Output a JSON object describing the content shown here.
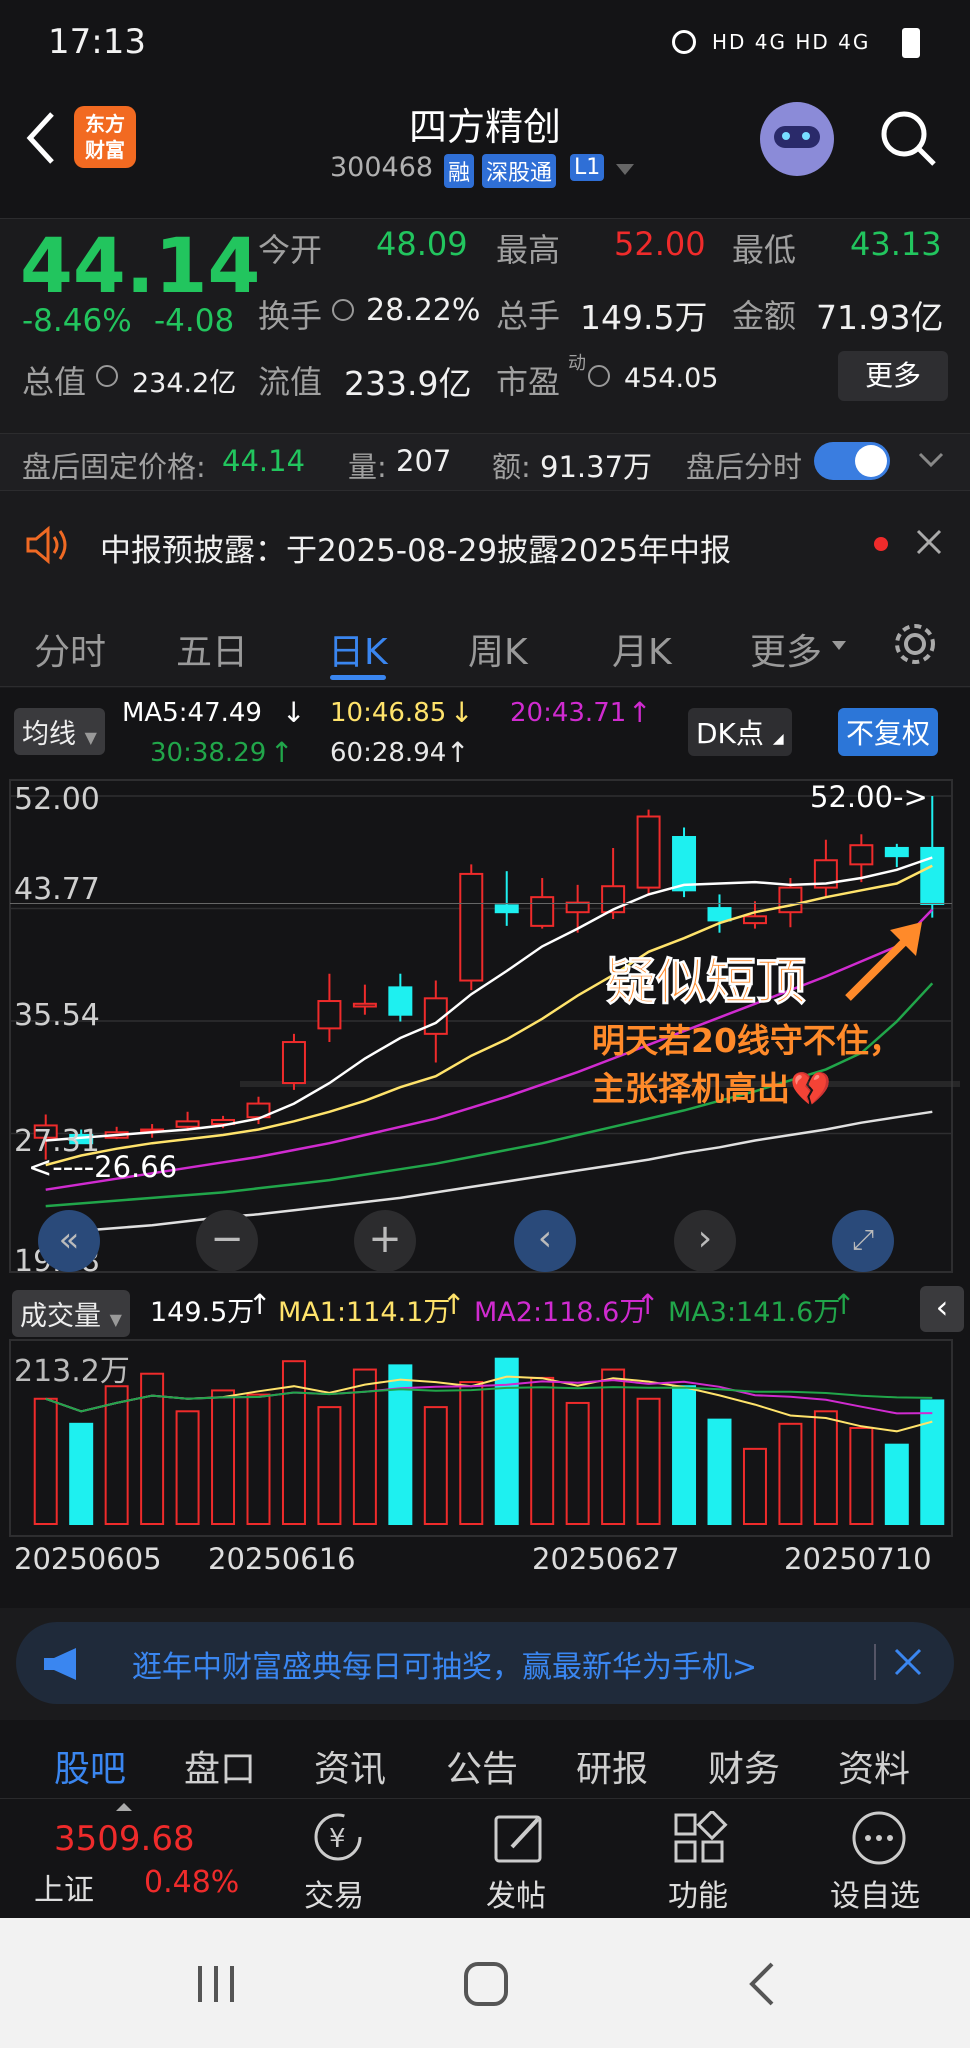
{
  "status": {
    "time": "17:13",
    "indicators": "HD 4G HD 4G"
  },
  "header": {
    "title": "四方精创",
    "code": "300468",
    "badges": [
      "融",
      "深股通",
      "L1"
    ],
    "logo_text": "东方财富"
  },
  "quote": {
    "price": "44.14",
    "pct": "-8.46%",
    "chg": "-4.08",
    "open_label": "今开",
    "open": "48.09",
    "high_label": "最高",
    "high": "52.00",
    "low_label": "最低",
    "low": "43.13",
    "turn_label": "换手",
    "turn": "28.22%",
    "vol_label": "总手",
    "vol": "149.5万",
    "amt_label": "金额",
    "amt": "71.93亿",
    "mcap_label": "总值",
    "mcap": "234.2亿",
    "float_label": "流值",
    "float": "233.9亿",
    "pe_label": "市盈",
    "pe_sup": "动",
    "pe": "454.05",
    "more": "更多"
  },
  "after": {
    "price_label": "盘后固定价格:",
    "price": "44.14",
    "vol_label": "量:",
    "vol": "207",
    "amt_label": "额:",
    "amt": "91.37万",
    "toggle_label": "盘后分时",
    "toggle_on": true
  },
  "notice": {
    "text": "中报预披露：于2025-08-29披露2025年中报"
  },
  "tabs": [
    "分时",
    "五日",
    "日K",
    "周K",
    "月K",
    "更多"
  ],
  "active_tab": 2,
  "ma": {
    "btn": "均线",
    "ma5": "MA5:47.49",
    "ma10": "10:46.85",
    "ma20": "20:43.71",
    "ma30": "30:38.29",
    "ma60": "60:28.94",
    "dk": "DK点",
    "fq": "不复权"
  },
  "chart": {
    "yticks": [
      "52.00",
      "43.77",
      "35.54",
      "27.31",
      "19.08"
    ],
    "high_label": "52.00->",
    "low_label": "<----26.66",
    "annot_title": "疑似短顶",
    "annot_line1": "明天若20线守不住，",
    "annot_line2": "主张择机高出💔"
  },
  "volume": {
    "btn": "成交量",
    "v": "149.5万",
    "ma1": "MA1:114.1万",
    "ma2": "MA2:118.6万",
    "ma3": "MA3:141.6万",
    "ytick": "213.2万"
  },
  "xdates": [
    "20250605",
    "20250616",
    "20250627",
    "20250710"
  ],
  "ad": {
    "text": "逛年中财富盛典每日可抽奖，赢最新华为手机>"
  },
  "bottom_tabs": [
    "股吧",
    "盘口",
    "资讯",
    "公告",
    "研报",
    "财务",
    "资料"
  ],
  "dock": {
    "index_value": "3509.68",
    "index_name": "上证",
    "index_pct": "0.48%",
    "items": [
      "交易",
      "发帖",
      "功能",
      "设自选"
    ]
  },
  "chart_data": {
    "type": "candlestick",
    "ylim": [
      19.08,
      52.0
    ],
    "candles": [
      {
        "o": 27.0,
        "c": 27.9,
        "h": 28.7,
        "l": 25.4
      },
      {
        "o": 27.2,
        "c": 26.6,
        "h": 27.6,
        "l": 26.6
      },
      {
        "o": 27.0,
        "c": 27.4,
        "h": 27.8,
        "l": 26.9
      },
      {
        "o": 27.5,
        "c": 27.6,
        "h": 28.0,
        "l": 27.0
      },
      {
        "o": 27.8,
        "c": 28.2,
        "h": 28.9,
        "l": 27.5
      },
      {
        "o": 28.0,
        "c": 28.3,
        "h": 28.6,
        "l": 27.7
      },
      {
        "o": 28.5,
        "c": 29.5,
        "h": 30.0,
        "l": 28.0
      },
      {
        "o": 31.0,
        "c": 34.0,
        "h": 34.6,
        "l": 30.5
      },
      {
        "o": 35.0,
        "c": 37.0,
        "h": 39.0,
        "l": 34.0
      },
      {
        "o": 36.6,
        "c": 36.8,
        "h": 38.2,
        "l": 36.0
      },
      {
        "o": 38.0,
        "c": 36.0,
        "h": 39.0,
        "l": 35.5
      },
      {
        "o": 34.6,
        "c": 37.2,
        "h": 38.5,
        "l": 32.5
      },
      {
        "o": 38.5,
        "c": 46.3,
        "h": 47.0,
        "l": 37.8
      },
      {
        "o": 44.0,
        "c": 43.5,
        "h": 46.5,
        "l": 42.5
      },
      {
        "o": 42.5,
        "c": 44.6,
        "h": 46.0,
        "l": 42.3
      },
      {
        "o": 43.5,
        "c": 44.2,
        "h": 45.5,
        "l": 42.0
      },
      {
        "o": 43.5,
        "c": 45.4,
        "h": 48.2,
        "l": 43.0
      },
      {
        "o": 45.3,
        "c": 50.5,
        "h": 51.0,
        "l": 44.7
      },
      {
        "o": 49.0,
        "c": 45.1,
        "h": 49.7,
        "l": 44.6
      },
      {
        "o": 43.8,
        "c": 42.9,
        "h": 44.8,
        "l": 42.0
      },
      {
        "o": 42.7,
        "c": 43.2,
        "h": 44.3,
        "l": 42.3
      },
      {
        "o": 43.5,
        "c": 45.3,
        "h": 46.0,
        "l": 42.4
      },
      {
        "o": 45.3,
        "c": 47.3,
        "h": 48.8,
        "l": 44.6
      },
      {
        "o": 47.0,
        "c": 48.4,
        "h": 49.2,
        "l": 45.7
      },
      {
        "o": 48.2,
        "c": 47.6,
        "h": 48.5,
        "l": 46.8
      },
      {
        "o": 48.2,
        "c": 44.1,
        "h": 52.0,
        "l": 43.1
      }
    ],
    "ma5": [
      26.8,
      27.0,
      27.2,
      27.4,
      27.6,
      27.9,
      28.4,
      29.5,
      31.0,
      32.8,
      34.3,
      35.4,
      37.5,
      39.2,
      41.0,
      42.3,
      43.7,
      44.8,
      45.5,
      45.6,
      45.7,
      45.5,
      45.6,
      46.0,
      46.6,
      47.5
    ],
    "ma10": [
      25.0,
      25.7,
      26.2,
      26.6,
      26.9,
      27.2,
      27.6,
      28.2,
      28.9,
      29.7,
      30.7,
      31.5,
      33.0,
      34.2,
      35.7,
      37.4,
      38.9,
      40.6,
      41.6,
      42.7,
      43.5,
      44.0,
      44.6,
      45.1,
      45.6,
      46.9
    ],
    "ma20": [
      23.2,
      23.6,
      24.0,
      24.4,
      24.8,
      25.2,
      25.6,
      26.1,
      26.6,
      27.2,
      27.8,
      28.4,
      29.2,
      30.0,
      30.9,
      31.8,
      32.8,
      33.8,
      34.8,
      35.8,
      36.8,
      37.8,
      38.8,
      39.9,
      41.0,
      43.7
    ],
    "ma30": [
      22.0,
      22.2,
      22.4,
      22.6,
      22.8,
      23.0,
      23.3,
      23.6,
      23.9,
      24.3,
      24.7,
      25.1,
      25.6,
      26.1,
      26.6,
      27.2,
      27.8,
      28.4,
      29.0,
      29.7,
      30.4,
      31.2,
      32.0,
      33.2,
      35.5,
      38.3
    ],
    "ma60": [
      19.9,
      20.2,
      20.4,
      20.6,
      20.9,
      21.2,
      21.4,
      21.7,
      22.0,
      22.3,
      22.6,
      23.0,
      23.4,
      23.8,
      24.2,
      24.6,
      25.0,
      25.4,
      25.9,
      26.3,
      26.8,
      27.2,
      27.6,
      28.1,
      28.5,
      28.9
    ],
    "volumes": [
      150,
      120,
      165,
      180,
      135,
      160,
      155,
      195,
      140,
      185,
      190,
      140,
      170,
      198,
      175,
      145,
      185,
      150,
      165,
      125,
      90,
      120,
      135,
      115,
      95,
      148
    ],
    "vol_ylim": [
      0,
      213.2
    ]
  }
}
